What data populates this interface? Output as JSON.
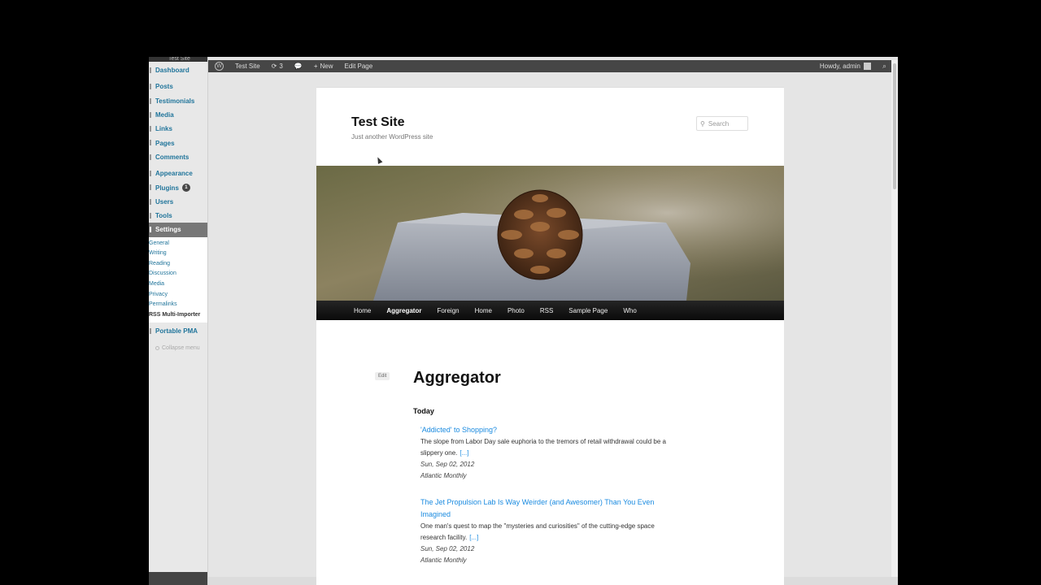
{
  "sidebar": {
    "top_label": "Test Site",
    "items": [
      {
        "label": "Dashboard"
      },
      {
        "label": "Posts"
      },
      {
        "label": "Testimonials"
      },
      {
        "label": "Media"
      },
      {
        "label": "Links"
      },
      {
        "label": "Pages"
      },
      {
        "label": "Comments"
      },
      {
        "label": "Appearance"
      },
      {
        "label": "Plugins",
        "badge": "1"
      },
      {
        "label": "Users"
      },
      {
        "label": "Tools"
      },
      {
        "label": "Settings"
      }
    ],
    "settings_submenu": [
      "General",
      "Writing",
      "Reading",
      "Discussion",
      "Media",
      "Privacy",
      "Permalinks",
      "RSS Multi-Importer"
    ],
    "after_items": [
      {
        "label": "Portable PMA"
      }
    ],
    "collapse_label": "Collapse menu"
  },
  "adminbar": {
    "site": "Test Site",
    "updates": "3",
    "new_label": "New",
    "edit_label": "Edit Page",
    "howdy": "Howdy, admin"
  },
  "site": {
    "title": "Test Site",
    "description": "Just another WordPress site",
    "search_placeholder": "Search"
  },
  "nav": [
    "Home",
    "Aggregator",
    "Foreign",
    "Home",
    "Photo",
    "RSS",
    "Sample Page",
    "Who"
  ],
  "page": {
    "edit_label": "Edit",
    "title": "Aggregator",
    "day_heading": "Today"
  },
  "feeds": [
    {
      "title": "'Addicted' to Shopping?",
      "excerpt_1": "The slope from Labor Day sale euphoria to the tremors of retail withdrawal could be a",
      "excerpt_2": "slippery one.",
      "more": "[...]",
      "date": "Sun, Sep 02, 2012",
      "source": "Atlantic Monthly"
    },
    {
      "title_1": "The Jet Propulsion Lab Is Way Weirder (and Awesomer) Than You Even",
      "title_2": "Imagined",
      "excerpt_1": "One man's quest to map the \"mysteries and curiosities\" of the cutting-edge space",
      "excerpt_2": "research facility.",
      "more": "[...]",
      "date": "Sun, Sep 02, 2012",
      "source": "Atlantic Monthly"
    }
  ],
  "colors": {
    "link": "#1b8be0",
    "admin_link": "#21759b",
    "adminbar_bg": "#464646"
  }
}
